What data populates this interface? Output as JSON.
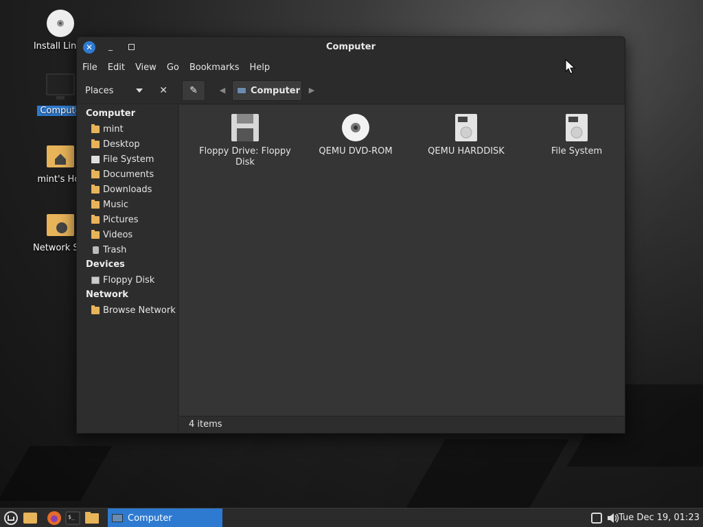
{
  "desktop": {
    "icons": [
      {
        "label": "Install Linux"
      },
      {
        "label": "Compute"
      },
      {
        "label": "mint's Hor"
      },
      {
        "label": "Network Ser"
      }
    ]
  },
  "window": {
    "title": "Computer",
    "menu": [
      "File",
      "Edit",
      "View",
      "Go",
      "Bookmarks",
      "Help"
    ],
    "places_label": "Places",
    "breadcrumb": "Computer",
    "sidebar": {
      "sections": [
        {
          "title": "Computer",
          "items": [
            "mint",
            "Desktop",
            "File System",
            "Documents",
            "Downloads",
            "Music",
            "Pictures",
            "Videos",
            "Trash"
          ]
        },
        {
          "title": "Devices",
          "items": [
            "Floppy Disk"
          ]
        },
        {
          "title": "Network",
          "items": [
            "Browse Network"
          ]
        }
      ]
    },
    "files": [
      {
        "line1": "Floppy Drive: Floppy",
        "line2": "Disk"
      },
      {
        "line1": "QEMU DVD-ROM",
        "line2": ""
      },
      {
        "line1": "QEMU HARDDISK",
        "line2": ""
      },
      {
        "line1": "File System",
        "line2": ""
      }
    ],
    "status": "4 items"
  },
  "taskbar": {
    "task_label": "Computer",
    "clock": "Tue Dec 19, 01:23"
  },
  "colors": {
    "accent": "#2e7ad1",
    "folder": "#e8b45a"
  }
}
